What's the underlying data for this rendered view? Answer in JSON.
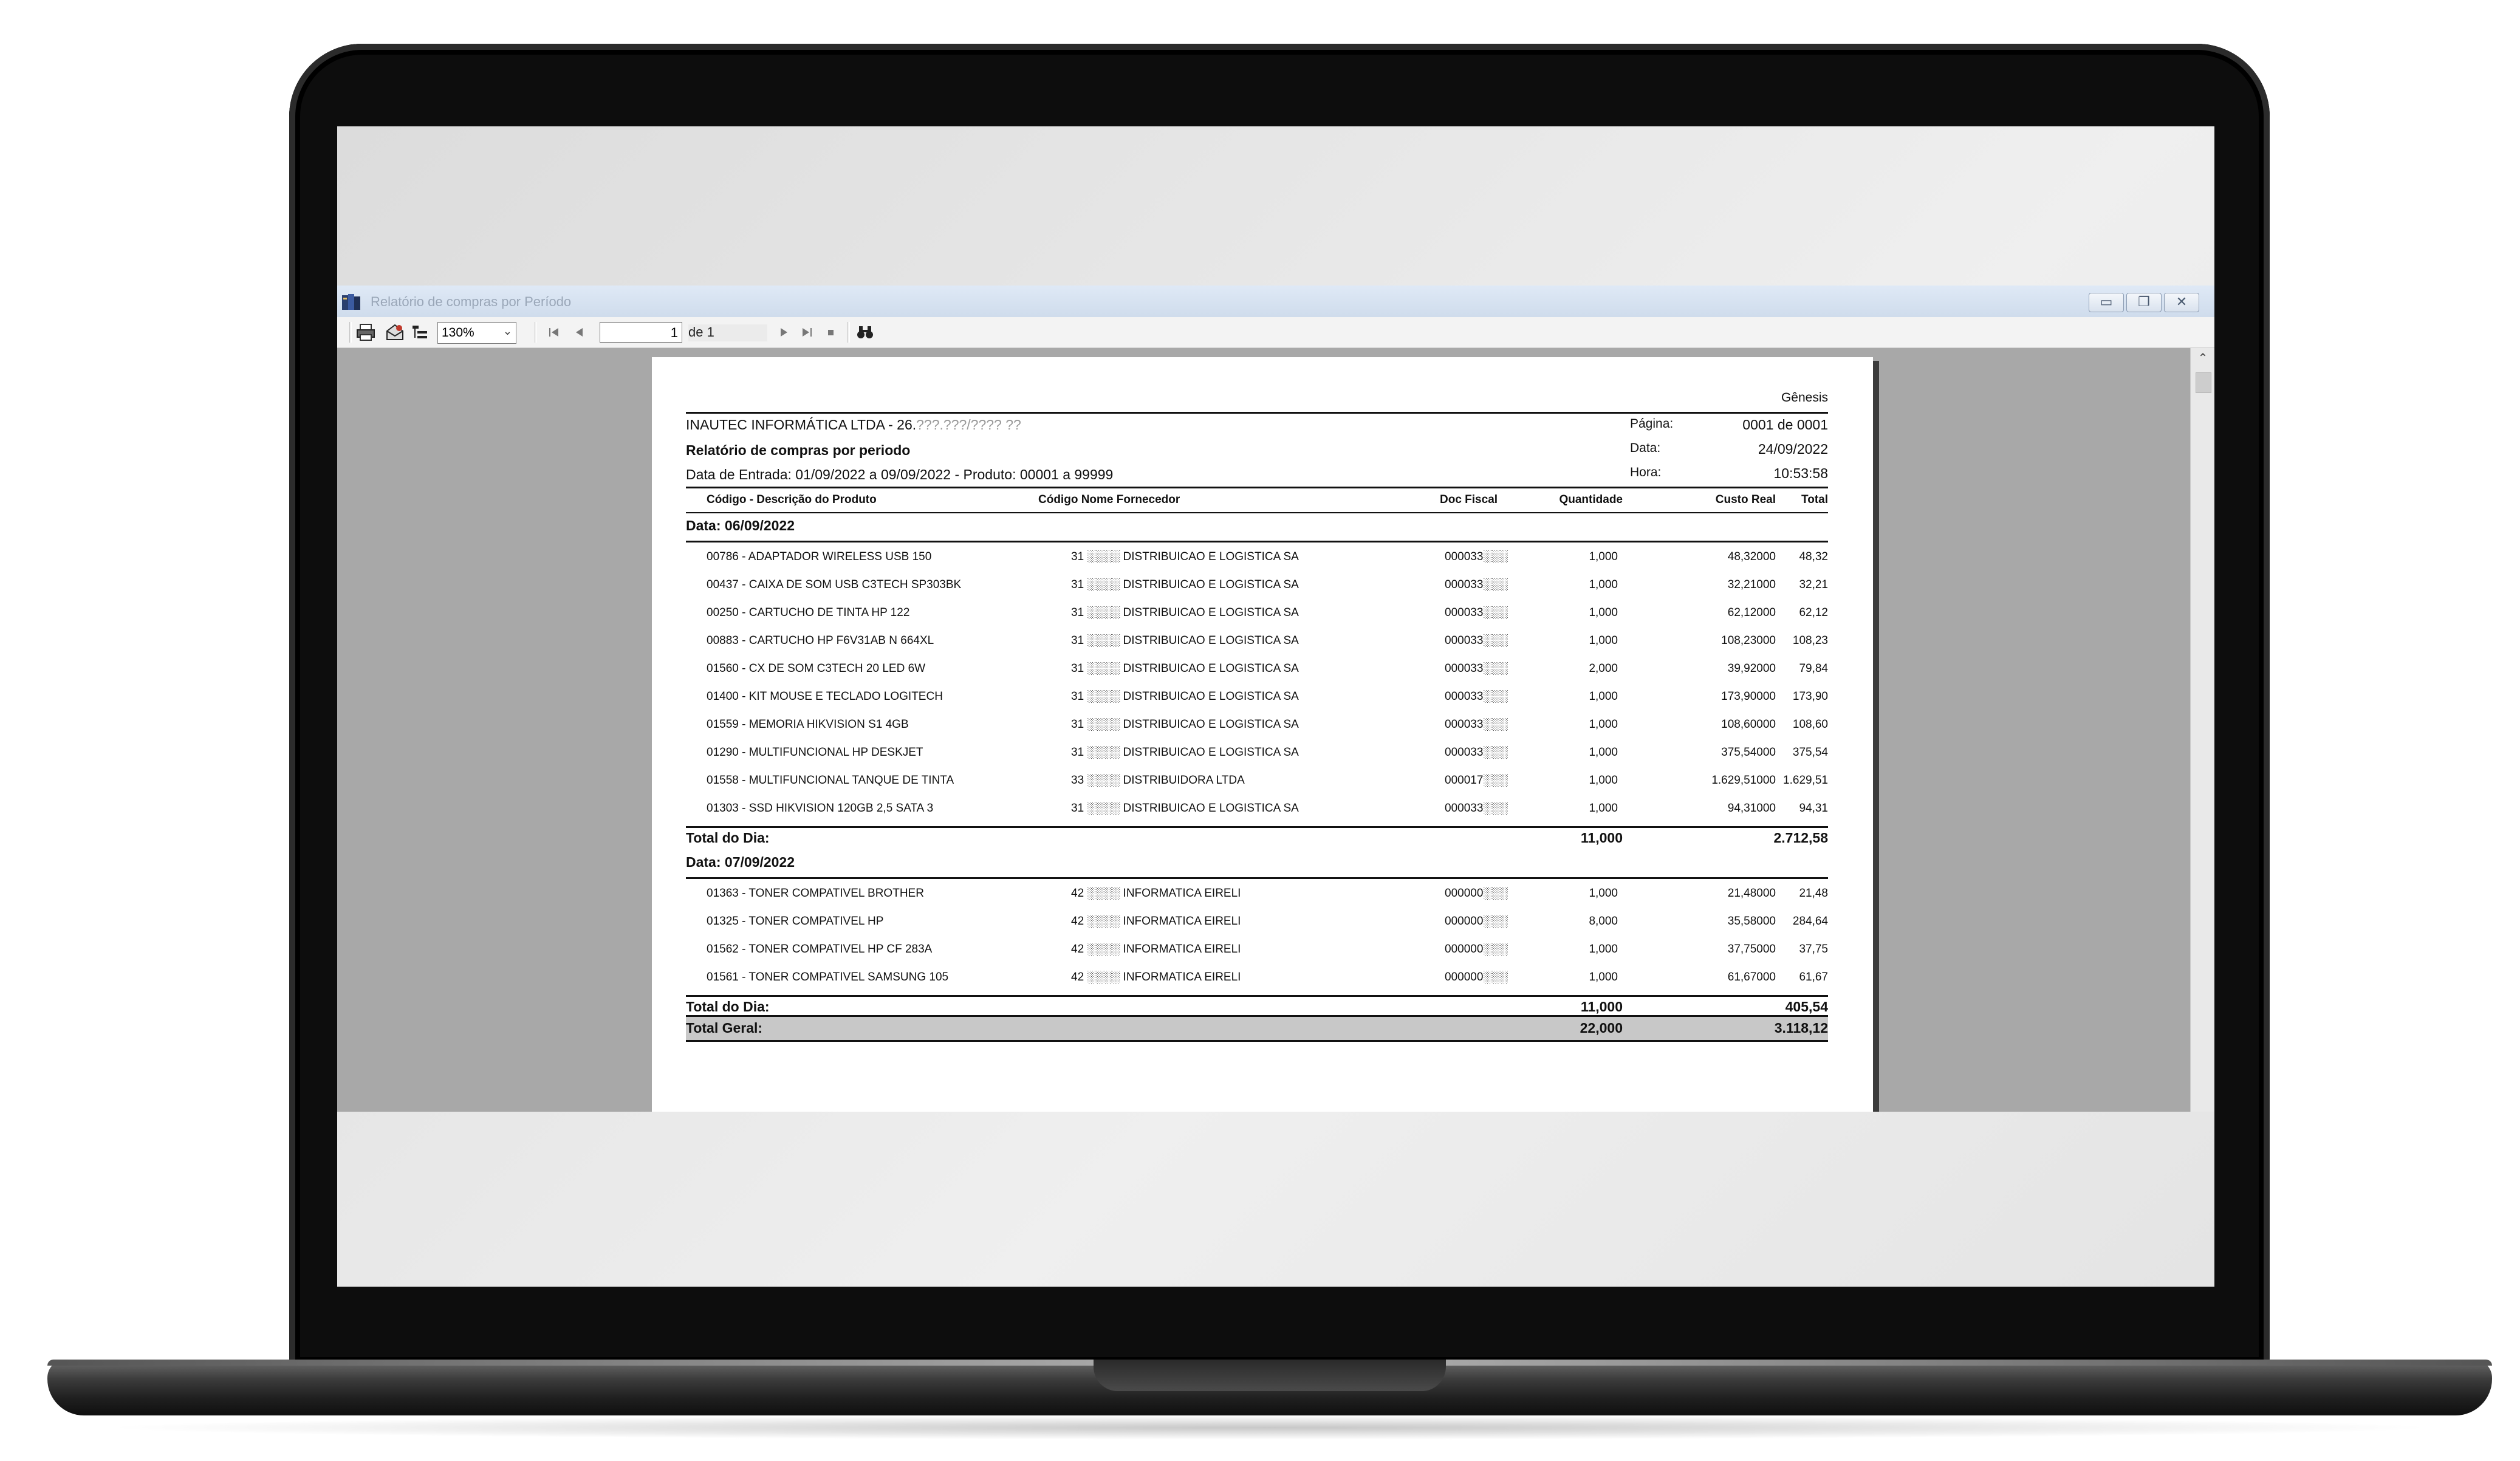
{
  "window": {
    "title": "Relatório de compras por Período",
    "buttons": {
      "minimize": "▭",
      "restore": "❐",
      "close": "✕"
    }
  },
  "toolbar": {
    "zoom": "130%",
    "current_page": "1",
    "page_of": "de 1"
  },
  "report": {
    "brand": "Gênesis",
    "company": "INAUTEC INFORMÁTICA LTDA - 26.",
    "company_masked": "???.???/???? ??",
    "title": "Relatório de compras por periodo",
    "filter": "Data de Entrada: 01/09/2022 a 09/09/2022 - Produto: 00001 a 99999",
    "page_label": "Página:",
    "page_value": "0001 de 0001",
    "date_label": "Data:",
    "date_value": "24/09/2022",
    "time_label": "Hora:",
    "time_value": "10:53:58",
    "columns": {
      "product": "Código - Descrição do Produto",
      "supplier": "Código Nome Fornecedor",
      "doc": "Doc Fiscal",
      "qty": "Quantidade",
      "cost": "Custo Real",
      "total": "Total"
    },
    "groups": [
      {
        "date": "Data: 06/09/2022",
        "rows": [
          {
            "product": "00786 - ADAPTADOR WIRELESS USB 150",
            "supplier": "31 ░░░░ DISTRIBUICAO E LOGISTICA SA",
            "doc": "000033░░░",
            "qty": "1,000",
            "cost": "48,32000",
            "total": "48,32"
          },
          {
            "product": "00437 - CAIXA DE SOM USB C3TECH SP303BK",
            "supplier": "31 ░░░░ DISTRIBUICAO E LOGISTICA SA",
            "doc": "000033░░░",
            "qty": "1,000",
            "cost": "32,21000",
            "total": "32,21"
          },
          {
            "product": "00250 - CARTUCHO DE TINTA HP 122",
            "supplier": "31 ░░░░ DISTRIBUICAO E LOGISTICA SA",
            "doc": "000033░░░",
            "qty": "1,000",
            "cost": "62,12000",
            "total": "62,12"
          },
          {
            "product": "00883 - CARTUCHO HP F6V31AB N 664XL",
            "supplier": "31 ░░░░ DISTRIBUICAO E LOGISTICA SA",
            "doc": "000033░░░",
            "qty": "1,000",
            "cost": "108,23000",
            "total": "108,23"
          },
          {
            "product": "01560 - CX DE SOM C3TECH 20 LED 6W",
            "supplier": "31 ░░░░ DISTRIBUICAO E LOGISTICA SA",
            "doc": "000033░░░",
            "qty": "2,000",
            "cost": "39,92000",
            "total": "79,84"
          },
          {
            "product": "01400 - KIT MOUSE E TECLADO LOGITECH",
            "supplier": "31 ░░░░ DISTRIBUICAO E LOGISTICA SA",
            "doc": "000033░░░",
            "qty": "1,000",
            "cost": "173,90000",
            "total": "173,90"
          },
          {
            "product": "01559 - MEMORIA HIKVISION S1 4GB",
            "supplier": "31 ░░░░ DISTRIBUICAO E LOGISTICA SA",
            "doc": "000033░░░",
            "qty": "1,000",
            "cost": "108,60000",
            "total": "108,60"
          },
          {
            "product": "01290 - MULTIFUNCIONAL HP DESKJET",
            "supplier": "31 ░░░░ DISTRIBUICAO E LOGISTICA SA",
            "doc": "000033░░░",
            "qty": "1,000",
            "cost": "375,54000",
            "total": "375,54"
          },
          {
            "product": "01558 - MULTIFUNCIONAL TANQUE DE TINTA",
            "supplier": "33 ░░░░ DISTRIBUIDORA LTDA",
            "doc": "000017░░░",
            "qty": "1,000",
            "cost": "1.629,51000",
            "total": "1.629,51"
          },
          {
            "product": "01303 - SSD HIKVISION 120GB 2,5 SATA 3",
            "supplier": "31 ░░░░ DISTRIBUICAO E LOGISTICA SA",
            "doc": "000033░░░",
            "qty": "1,000",
            "cost": "94,31000",
            "total": "94,31"
          }
        ],
        "total_label": "Total do Dia:",
        "total_qty": "11,000",
        "total_value": "2.712,58"
      },
      {
        "date": "Data: 07/09/2022",
        "rows": [
          {
            "product": "01363 - TONER COMPATIVEL BROTHER",
            "supplier": "42 ░░░░ INFORMATICA EIRELI",
            "doc": "000000░░░",
            "qty": "1,000",
            "cost": "21,48000",
            "total": "21,48"
          },
          {
            "product": "01325 - TONER COMPATIVEL HP",
            "supplier": "42 ░░░░ INFORMATICA EIRELI",
            "doc": "000000░░░",
            "qty": "8,000",
            "cost": "35,58000",
            "total": "284,64"
          },
          {
            "product": "01562 - TONER COMPATIVEL HP CF 283A",
            "supplier": "42 ░░░░ INFORMATICA EIRELI",
            "doc": "000000░░░",
            "qty": "1,000",
            "cost": "37,75000",
            "total": "37,75"
          },
          {
            "product": "01561 - TONER COMPATIVEL SAMSUNG 105",
            "supplier": "42 ░░░░ INFORMATICA EIRELI",
            "doc": "000000░░░",
            "qty": "1,000",
            "cost": "61,67000",
            "total": "61,67"
          }
        ],
        "total_label": "Total do Dia:",
        "total_qty": "11,000",
        "total_value": "405,54"
      }
    ],
    "grand_label": "Total Geral:",
    "grand_qty": "22,000",
    "grand_value": "3.118,12"
  }
}
